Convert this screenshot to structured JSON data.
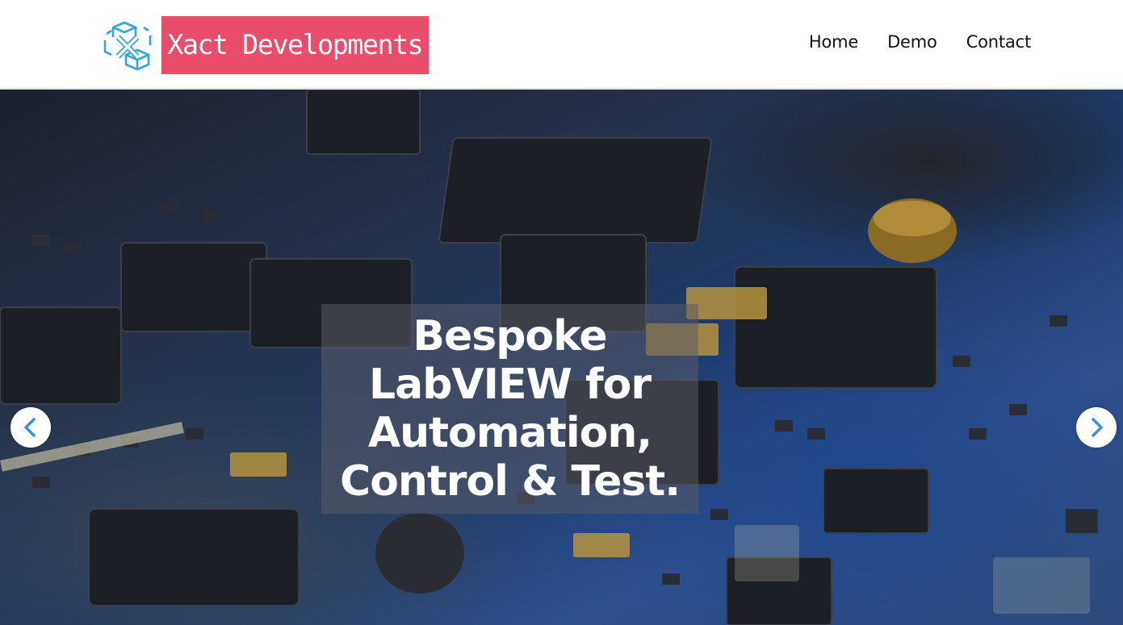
{
  "brand": {
    "name": "Xact Developments",
    "logo_icon": "x-cube-icon",
    "accent_color": "#ea4d6b",
    "icon_color": "#2ea8d6"
  },
  "nav": {
    "items": [
      {
        "label": "Home"
      },
      {
        "label": "Demo"
      },
      {
        "label": "Contact"
      }
    ]
  },
  "hero": {
    "headline_lines": [
      "Bespoke",
      "LabVIEW for",
      "Automation,",
      "Control & Test."
    ],
    "prev_icon": "chevron-left-icon",
    "next_icon": "chevron-right-icon"
  }
}
